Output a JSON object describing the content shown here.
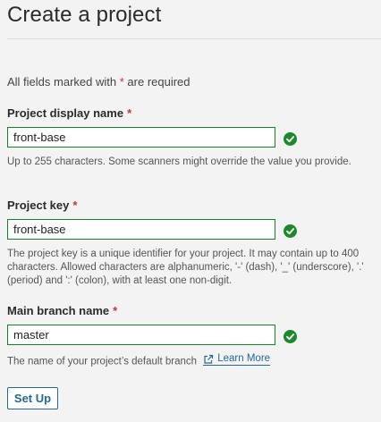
{
  "title": "Create a project",
  "required_note": {
    "prefix": "All fields marked with",
    "asterisk": "*",
    "suffix": "are required"
  },
  "fields": [
    {
      "label": "Project display name",
      "asterisk": "*",
      "value": "front-base",
      "help": "Up to 255 characters. Some scanners might override the value you provide."
    },
    {
      "label": "Project key",
      "asterisk": "*",
      "value": "front-base",
      "help": "The project key is a unique identifier for your project. It may contain up to 400 characters. Allowed characters are alphanumeric, '-' (dash), '_' (underscore), '.' (period) and ':' (colon), with at least one non-digit."
    },
    {
      "label": "Main branch name",
      "asterisk": "*",
      "value": "master",
      "help": "The name of your project’s default branch",
      "link_text": "Learn More"
    }
  ],
  "submit_label": "Set Up",
  "colors": {
    "valid": "#1a8a2a",
    "accent": "#236a97",
    "required": "#d02f3a"
  },
  "icons": {
    "valid": "check-circle-icon",
    "external": "external-link-icon"
  }
}
